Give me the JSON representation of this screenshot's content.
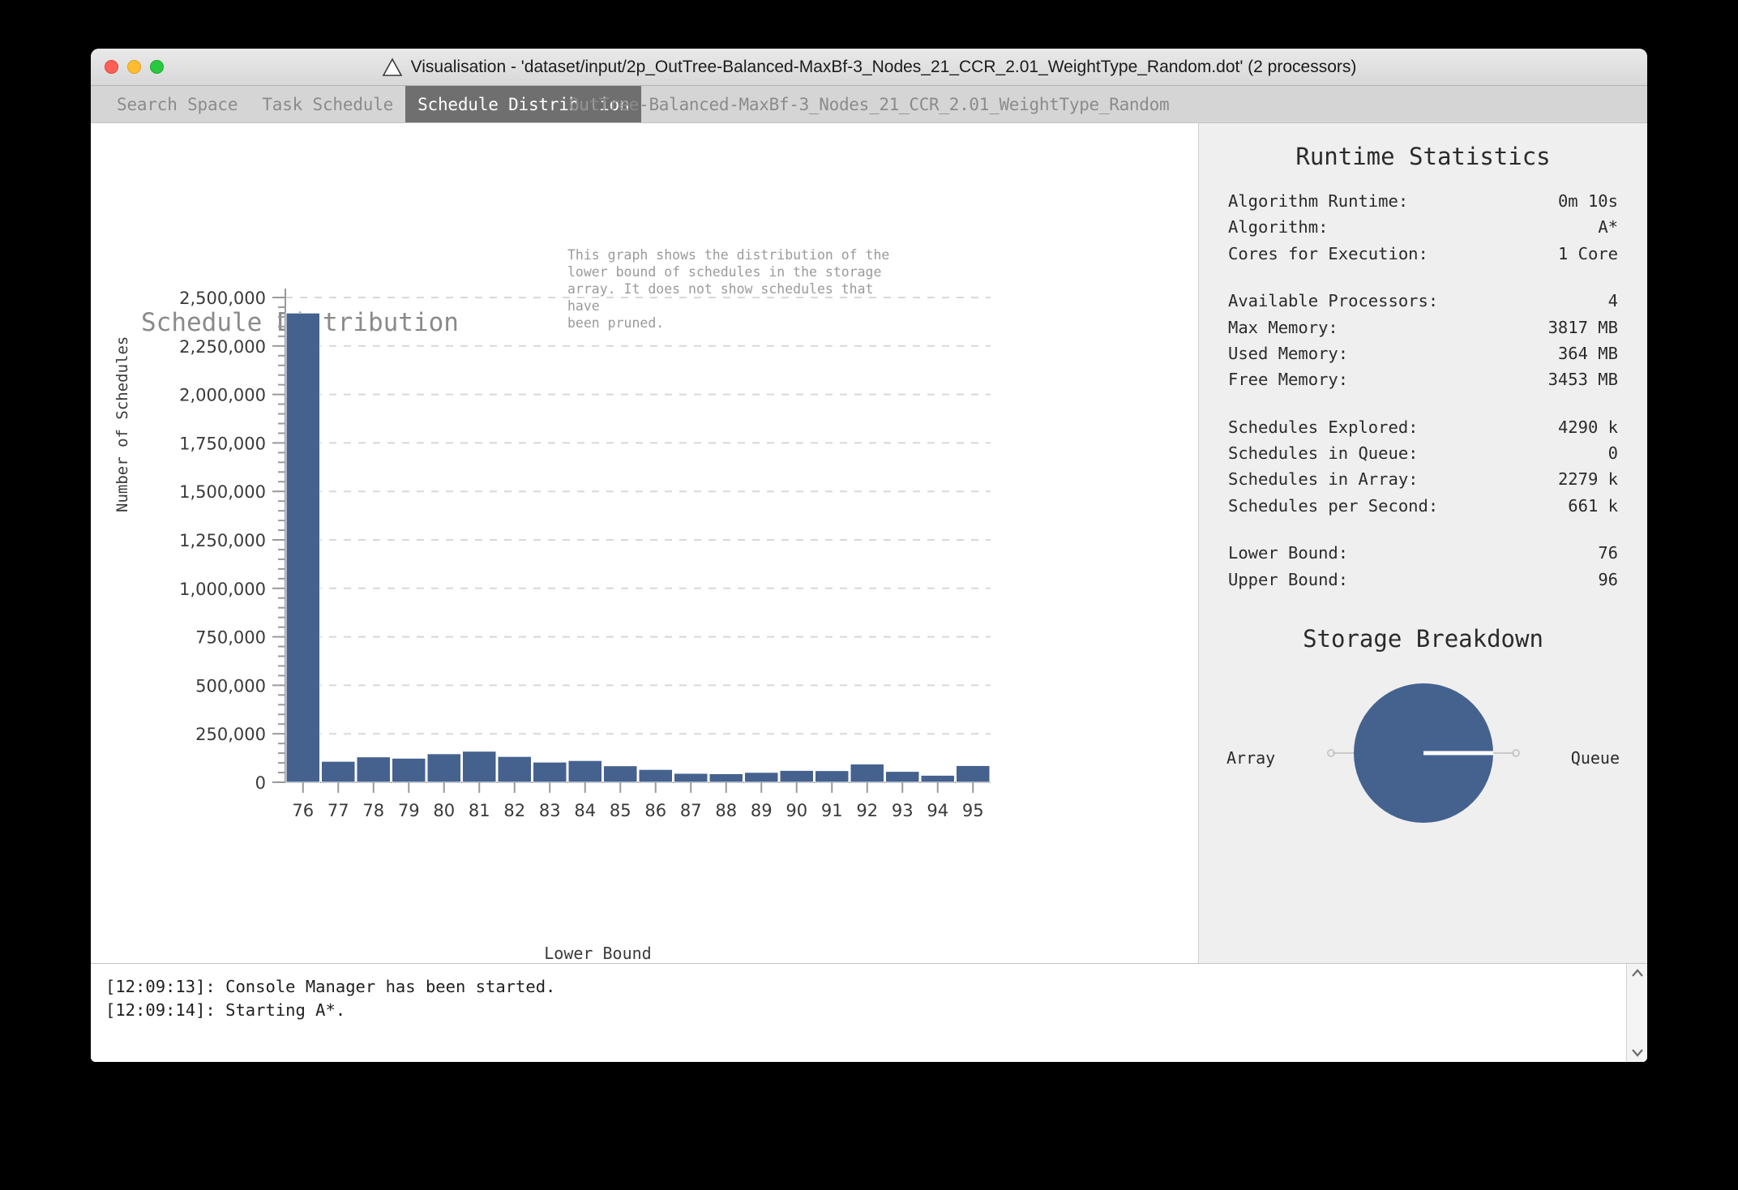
{
  "window": {
    "title": "Visualisation - 'dataset/input/2p_OutTree-Balanced-MaxBf-3_Nodes_21_CCR_2.01_WeightType_Random.dot' (2 processors)",
    "app_icon": "triangle-icon",
    "traffic_lights": [
      "close-button",
      "minimize-button",
      "zoom-button"
    ]
  },
  "tabs": [
    {
      "label": "Search Space",
      "active": false
    },
    {
      "label": "Task Schedule",
      "active": false
    },
    {
      "label": "Schedule Distribution",
      "active": true
    }
  ],
  "graph_name": "OutTree-Balanced-MaxBf-3_Nodes_21_CCR_2.01_WeightType_Random",
  "blurb": "This graph shows the distribution of the\nlower bound of schedules in the storage\narray. It does not show schedules that have\nbeen pruned.",
  "statistics": {
    "heading": "Runtime Statistics",
    "groups": [
      [
        {
          "key": "Algorithm Runtime:",
          "value": "0m 10s"
        },
        {
          "key": "Algorithm:",
          "value": "A*"
        },
        {
          "key": "Cores for Execution:",
          "value": "1 Core"
        }
      ],
      [
        {
          "key": "Available Processors:",
          "value": "4"
        },
        {
          "key": "Max Memory:",
          "value": "3817 MB"
        },
        {
          "key": "Used Memory:",
          "value": "364 MB"
        },
        {
          "key": "Free Memory:",
          "value": "3453 MB"
        }
      ],
      [
        {
          "key": "Schedules Explored:",
          "value": "4290 k"
        },
        {
          "key": "Schedules in Queue:",
          "value": "0"
        },
        {
          "key": "Schedules in Array:",
          "value": "2279 k"
        },
        {
          "key": "Schedules per Second:",
          "value": "661 k"
        }
      ],
      [
        {
          "key": "Lower Bound:",
          "value": "76"
        },
        {
          "key": "Upper Bound:",
          "value": "96"
        }
      ]
    ]
  },
  "storage": {
    "heading": "Storage Breakdown",
    "label_left": "Array",
    "label_right": "Queue"
  },
  "console": {
    "lines": "[12:09:13]: Console Manager has been started.\n[12:09:14]: Starting A*.",
    "scroll_up": "⌃",
    "scroll_down": "⌄"
  },
  "colors": {
    "bar": "#45628f",
    "pie_array": "#45628f",
    "pie_queue": "#ffffff",
    "axis": "#9a9a9a",
    "tab_active_bg": "#6f6f6f",
    "grid": "#d8d8d8"
  },
  "chart_data": {
    "type": "bar",
    "title": "Schedule Distribution",
    "xlabel": "Lower Bound",
    "ylabel": "Number of Schedules",
    "categories": [
      "76",
      "77",
      "78",
      "79",
      "80",
      "81",
      "82",
      "83",
      "84",
      "85",
      "86",
      "87",
      "88",
      "89",
      "90",
      "91",
      "92",
      "93",
      "94",
      "95"
    ],
    "values": [
      2420000,
      108000,
      131000,
      124000,
      147000,
      160000,
      133000,
      104000,
      112000,
      85000,
      66000,
      46000,
      44000,
      51000,
      61000,
      60000,
      94000,
      56000,
      36000,
      86000
    ],
    "ylim": [
      0,
      2500000
    ],
    "ytick_step": 250000,
    "yticks": [
      0,
      250000,
      500000,
      750000,
      1000000,
      1250000,
      1500000,
      1750000,
      2000000,
      2250000,
      2500000
    ],
    "ytick_labels": [
      "0",
      "250,000",
      "500,000",
      "750,000",
      "1,000,000",
      "1,250,000",
      "1,500,000",
      "1,750,000",
      "2,000,000",
      "2,250,000",
      "2,500,000"
    ],
    "minor_ticks_per_major": 5,
    "grid": "horizontal-dashed",
    "legend": "none"
  },
  "pie_data": {
    "type": "pie",
    "title": "Storage Breakdown",
    "labels": [
      "Array",
      "Queue"
    ],
    "values": [
      100,
      0
    ]
  }
}
